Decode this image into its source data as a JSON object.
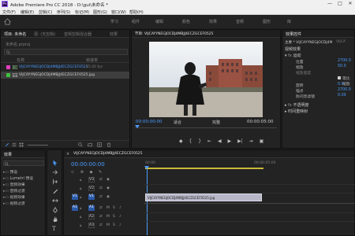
{
  "titlebar": {
    "logo": "Pr",
    "title": "Adobe Premiere Pro CC 2018 - D:\\gui\\未命名 *",
    "minimize": "—",
    "maximize": "□",
    "close": "✕"
  },
  "menu": [
    "文件(F)",
    "编辑(E)",
    "剪辑(C)",
    "序列(S)",
    "标记(M)",
    "图形(G)",
    "窗口(W)",
    "帮助(H)"
  ],
  "workspaces": [
    "学习",
    "组件",
    "编辑",
    "颜色",
    "效果",
    "音频",
    "图形",
    "库"
  ],
  "project": {
    "tabs": [
      "项目: 未命名",
      "源: (无剪辑)",
      "音频剪辑混合器",
      "效果"
    ],
    "file": "未命名.prproj",
    "col_name": "名称",
    "col_fps": "帧速率",
    "items": [
      {
        "name": "VIJCAYYNEGJOCDJ4MBJJ4ECZGCEF0525",
        "fps": "25.00 fps",
        "color": "#e040c0"
      },
      {
        "name": "VIJCAYYNEGJOCDJ4MBJJ4ECZGCEF0525.jpg",
        "fps": "",
        "color": "#40c040"
      }
    ]
  },
  "program": {
    "tab": "节目: VIJCAYYNEGJOCDJ4MBJJ4ECZGCEF0525",
    "timecode_left": "00:00:00:00",
    "fit": "适合",
    "quality": "完整",
    "timecode_right": "00:00:05:00"
  },
  "effects_controls": {
    "tab": "效果控件",
    "master": "主要 * VIJCAYYNEGJOCDJ4MBJJ4ECZGCEF0525.jpg",
    "sequence_label": "VIJCA",
    "section": "视频效果",
    "fx_motion": "运动",
    "props": [
      {
        "name": "位置",
        "value": "2700.0"
      },
      {
        "name": "缩放",
        "value": "50.0"
      },
      {
        "name": "缩放宽度",
        "value": ""
      },
      {
        "name": "等比缩放",
        "value": ""
      },
      {
        "name": "旋转",
        "value": "0.0"
      },
      {
        "name": "锚点",
        "value": "2700.0"
      },
      {
        "name": "防闪烁滤镜",
        "value": "0.00"
      }
    ],
    "fx_opacity": "不透明度",
    "fx_time": "时间重映射"
  },
  "effects_panel": {
    "title": "效果",
    "items": [
      "预设",
      "Lumetri 预设",
      "音频效果",
      "音频过渡",
      "视频效果",
      "视频过渡"
    ]
  },
  "timeline": {
    "sequence": "VIJCAYYNEGJOCDJ4MBJJ4ECZGCEF0525",
    "timecode": "00:00:00:00",
    "ruler_start": "00:00",
    "ruler_mid": "00:00:05:00",
    "tracks": [
      "V3",
      "V2",
      "V1",
      "A1",
      "A2",
      "A3"
    ],
    "clip": "VIJCAYYNEGJOCDJ4MBJJ4ECZGCEF0525.jpg"
  }
}
